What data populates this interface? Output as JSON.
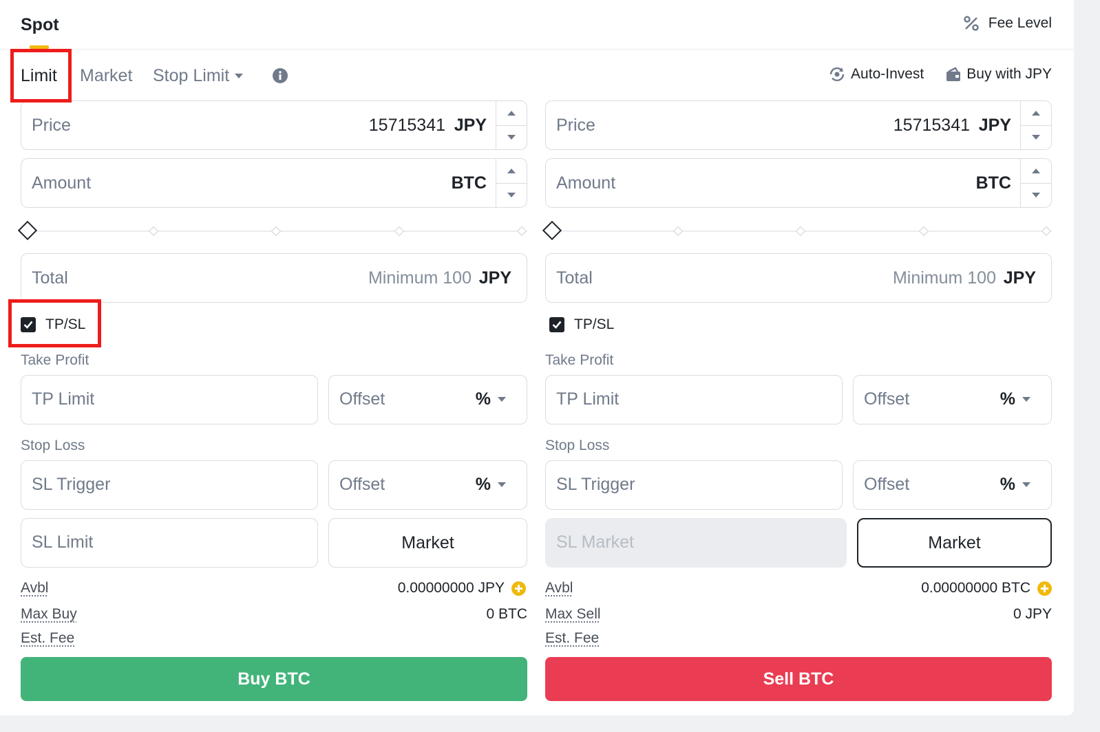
{
  "header": {
    "spot_tab": "Spot",
    "fee_level": "Fee Level",
    "fee_icon": "percent-icon"
  },
  "tabs": {
    "limit": "Limit",
    "market": "Market",
    "stop_limit": "Stop Limit",
    "info_icon": "info-icon"
  },
  "actions": {
    "auto_invest": "Auto-Invest",
    "buy_with": "Buy with JPY"
  },
  "buy": {
    "price_label": "Price",
    "price_value": "15715341",
    "price_unit": "JPY",
    "amount_label": "Amount",
    "amount_unit": "BTC",
    "total_label": "Total",
    "total_hint": "Minimum 100",
    "total_unit": "JPY",
    "tpsl_label": "TP/SL",
    "tpsl_checked": true,
    "take_profit_label": "Take Profit",
    "tp_limit_label": "TP Limit",
    "tp_offset_label": "Offset",
    "tp_offset_unit": "%",
    "stop_loss_label": "Stop Loss",
    "sl_trigger_label": "SL Trigger",
    "sl_offset_label": "Offset",
    "sl_offset_unit": "%",
    "sl_limit_label": "SL Limit",
    "sl_market_button": "Market",
    "avbl_label": "Avbl",
    "avbl_value": "0.00000000 JPY",
    "max_label": "Max Buy",
    "max_value": "0 BTC",
    "fee_label": "Est. Fee",
    "submit": "Buy BTC"
  },
  "sell": {
    "price_label": "Price",
    "price_value": "15715341",
    "price_unit": "JPY",
    "amount_label": "Amount",
    "amount_unit": "BTC",
    "total_label": "Total",
    "total_hint": "Minimum 100",
    "total_unit": "JPY",
    "tpsl_label": "TP/SL",
    "tpsl_checked": true,
    "take_profit_label": "Take Profit",
    "tp_limit_label": "TP Limit",
    "tp_offset_label": "Offset",
    "tp_offset_unit": "%",
    "stop_loss_label": "Stop Loss",
    "sl_trigger_label": "SL Trigger",
    "sl_offset_label": "Offset",
    "sl_offset_unit": "%",
    "sl_limit_label": "SL Market",
    "sl_market_button": "Market",
    "avbl_label": "Avbl",
    "avbl_value": "0.00000000 BTC",
    "max_label": "Max Sell",
    "max_value": "0 JPY",
    "fee_label": "Est. Fee",
    "submit": "Sell BTC"
  },
  "colors": {
    "buy": "#42b47a",
    "sell": "#ea3c52",
    "accent": "#f0b90b",
    "highlight": "#ee1c1c"
  }
}
